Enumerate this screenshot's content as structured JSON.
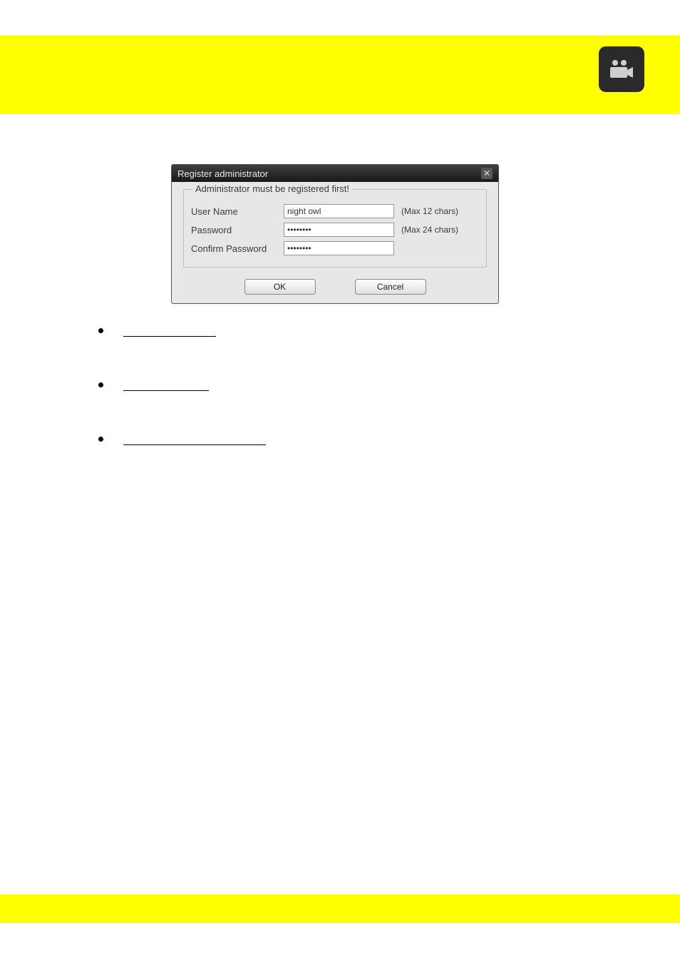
{
  "dialog": {
    "title": "Register administrator",
    "legend": "Administrator must be registered first!",
    "rows": {
      "username": {
        "label": "User Name",
        "value": "night owl",
        "hint": "(Max 12 chars)"
      },
      "password": {
        "label": "Password",
        "value": "********",
        "hint": "(Max 24 chars)"
      },
      "confirm": {
        "label": "Confirm Password",
        "value": "********"
      }
    },
    "buttons": {
      "ok": "OK",
      "cancel": "Cancel"
    }
  },
  "bullets": {
    "b1": "",
    "b2": "",
    "b3": ""
  }
}
